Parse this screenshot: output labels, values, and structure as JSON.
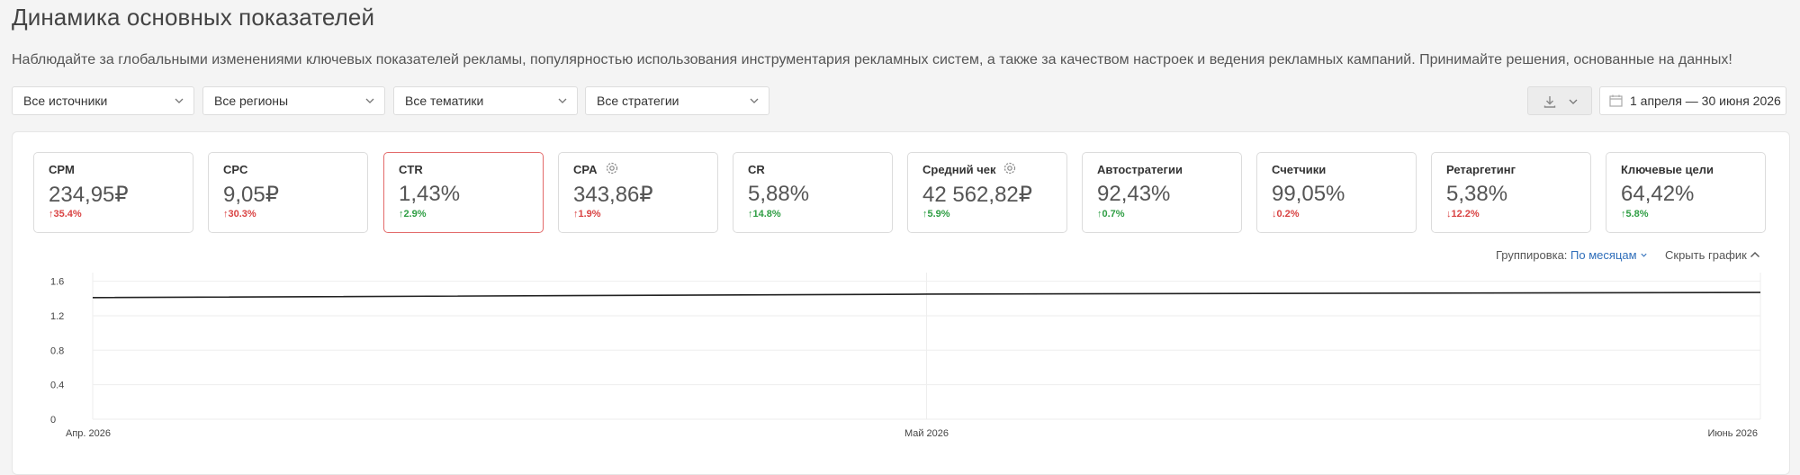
{
  "page": {
    "title": "Динамика основных показателей",
    "subtitle": "Наблюдайте за глобальными изменениями ключевых показателей рекламы, популярностью использования инструментария рекламных систем, а также за качеством настроек и ведения рекламных кампаний. Принимайте решения, основанные на данных!"
  },
  "filters": [
    {
      "label": "Все источники"
    },
    {
      "label": "Все регионы"
    },
    {
      "label": "Все тематики"
    },
    {
      "label": "Все стратегии"
    }
  ],
  "date_range": "1 апреля — 30 июня 2026",
  "metrics": [
    {
      "label": "CPM",
      "value": "234,95₽",
      "delta": "35.4%",
      "direction": "up",
      "color": "#d94343",
      "gear": false
    },
    {
      "label": "CPC",
      "value": "9,05₽",
      "delta": "30.3%",
      "direction": "up",
      "color": "#d94343",
      "gear": false
    },
    {
      "label": "CTR",
      "value": "1,43%",
      "delta": "2.9%",
      "direction": "up",
      "color": "#2f9e44",
      "gear": false,
      "active": true
    },
    {
      "label": "CPA",
      "value": "343,86₽",
      "delta": "1.9%",
      "direction": "up",
      "color": "#d94343",
      "gear": true
    },
    {
      "label": "CR",
      "value": "5,88%",
      "delta": "14.8%",
      "direction": "up",
      "color": "#2f9e44",
      "gear": false
    },
    {
      "label": "Средний чек",
      "value": "42 562,82₽",
      "delta": "5.9%",
      "direction": "up",
      "color": "#2f9e44",
      "gear": true
    },
    {
      "label": "Автостратегии",
      "value": "92,43%",
      "delta": "0.7%",
      "direction": "up",
      "color": "#2f9e44",
      "gear": false
    },
    {
      "label": "Счетчики",
      "value": "99,05%",
      "delta": "0.2%",
      "direction": "down",
      "color": "#d94343",
      "gear": false
    },
    {
      "label": "Ретаргетинг",
      "value": "5,38%",
      "delta": "12.2%",
      "direction": "down",
      "color": "#d94343",
      "gear": false
    },
    {
      "label": "Ключевые цели",
      "value": "64,42%",
      "delta": "5.8%",
      "direction": "up",
      "color": "#2f9e44",
      "gear": false
    }
  ],
  "chart_controls": {
    "grouping_label": "Группировка:",
    "grouping_value": "По месяцам",
    "hide_chart": "Скрыть график"
  },
  "chart_data": {
    "type": "line",
    "categories": [
      "Апр. 2026",
      "Май 2026",
      "Июнь 2026"
    ],
    "series": [
      {
        "values": [
          1.41,
          1.45,
          1.47
        ]
      }
    ],
    "y_ticks": [
      "0",
      "0.4",
      "0.8",
      "1.2",
      "1.6"
    ],
    "ylim": [
      0,
      1.7
    ],
    "grid": true,
    "line_color": "#222222"
  }
}
